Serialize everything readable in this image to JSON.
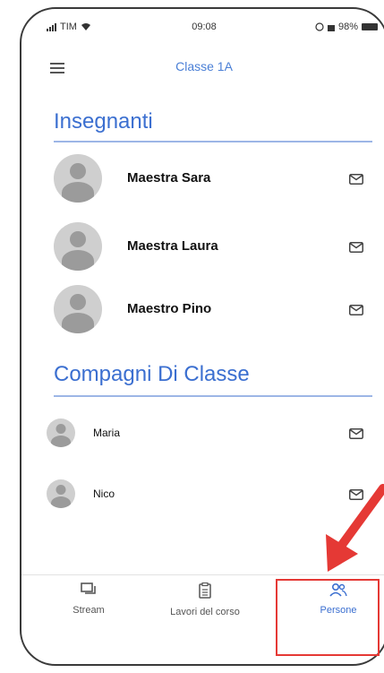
{
  "status_bar": {
    "carrier": "TIM",
    "time": "09:08",
    "battery": "98%"
  },
  "app_bar": {
    "title": "Classe 1A"
  },
  "teachers_section": {
    "title": "Insegnanti",
    "items": [
      {
        "name": "Maestra Sara"
      },
      {
        "name": "Maestra Laura"
      },
      {
        "name": "Maestro Pino"
      }
    ]
  },
  "classmates_section": {
    "title": "Compagni Di Classe",
    "items": [
      {
        "name": "Maria"
      },
      {
        "name": "Nico"
      }
    ]
  },
  "bottom_nav": {
    "items": [
      {
        "label": "Stream",
        "icon": "stream-icon"
      },
      {
        "label": "Lavori del corso",
        "icon": "classwork-icon"
      },
      {
        "label": "Persone",
        "icon": "people-icon",
        "active": true
      }
    ]
  },
  "colors": {
    "accent": "#3b6fd0",
    "highlight": "#e53935"
  }
}
